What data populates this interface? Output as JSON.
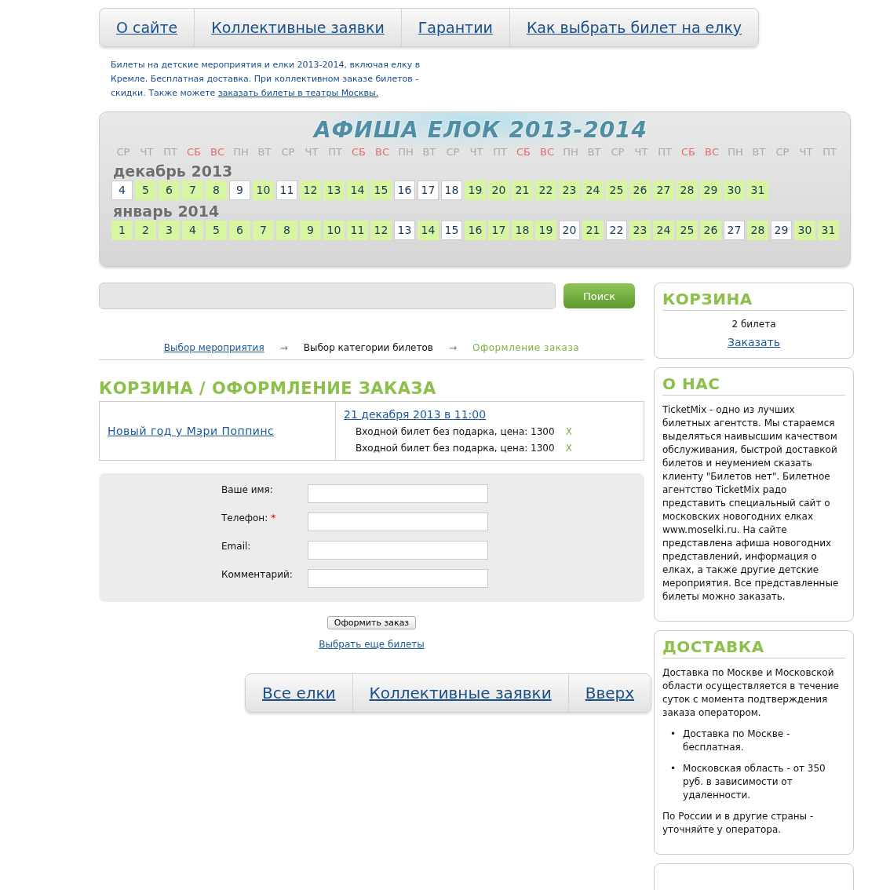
{
  "top_nav": [
    "О сайте",
    "Коллективные заявки",
    "Гарантии",
    "Как выбрать билет на елку"
  ],
  "intro": {
    "text": "Билеты на детские мероприятия и елки 2013-2014, включая елку в Кремле. Бесплатная доставка. При коллективном заказе билетов - скидки. Также можете ",
    "link": "заказать билеты в театры Москвы."
  },
  "calendar": {
    "title": "АФИША ЕЛОК 2013-2014",
    "weekdays": [
      {
        "label": "СР",
        "weekend": false
      },
      {
        "label": "ЧТ",
        "weekend": false
      },
      {
        "label": "ПТ",
        "weekend": false
      },
      {
        "label": "СБ",
        "weekend": true
      },
      {
        "label": "ВС",
        "weekend": true
      },
      {
        "label": "ПН",
        "weekend": false
      },
      {
        "label": "ВТ",
        "weekend": false
      },
      {
        "label": "СР",
        "weekend": false
      },
      {
        "label": "ЧТ",
        "weekend": false
      },
      {
        "label": "ПТ",
        "weekend": false
      },
      {
        "label": "СБ",
        "weekend": true
      },
      {
        "label": "ВС",
        "weekend": true
      },
      {
        "label": "ПН",
        "weekend": false
      },
      {
        "label": "ВТ",
        "weekend": false
      },
      {
        "label": "СР",
        "weekend": false
      },
      {
        "label": "ЧТ",
        "weekend": false
      },
      {
        "label": "ПТ",
        "weekend": false
      },
      {
        "label": "СБ",
        "weekend": true
      },
      {
        "label": "ВС",
        "weekend": true
      },
      {
        "label": "ПН",
        "weekend": false
      },
      {
        "label": "ВТ",
        "weekend": false
      },
      {
        "label": "СР",
        "weekend": false
      },
      {
        "label": "ЧТ",
        "weekend": false
      },
      {
        "label": "ПТ",
        "weekend": false
      },
      {
        "label": "СБ",
        "weekend": true
      },
      {
        "label": "ВС",
        "weekend": true
      },
      {
        "label": "ПН",
        "weekend": false
      },
      {
        "label": "ВТ",
        "weekend": false
      },
      {
        "label": "СР",
        "weekend": false
      },
      {
        "label": "ЧТ",
        "weekend": false
      },
      {
        "label": "ПТ",
        "weekend": false
      }
    ],
    "months": [
      {
        "name": "декабрь 2013",
        "days": [
          {
            "day": "4",
            "available": false
          },
          {
            "day": "5",
            "available": true
          },
          {
            "day": "6",
            "available": true
          },
          {
            "day": "7",
            "available": true
          },
          {
            "day": "8",
            "available": true
          },
          {
            "day": "9",
            "available": false
          },
          {
            "day": "10",
            "available": true
          },
          {
            "day": "11",
            "available": false
          },
          {
            "day": "12",
            "available": true
          },
          {
            "day": "13",
            "available": true
          },
          {
            "day": "14",
            "available": true
          },
          {
            "day": "15",
            "available": true
          },
          {
            "day": "16",
            "available": false
          },
          {
            "day": "17",
            "available": false
          },
          {
            "day": "18",
            "available": false
          },
          {
            "day": "19",
            "available": true
          },
          {
            "day": "20",
            "available": true
          },
          {
            "day": "21",
            "available": true
          },
          {
            "day": "22",
            "available": true
          },
          {
            "day": "23",
            "available": true
          },
          {
            "day": "24",
            "available": true
          },
          {
            "day": "25",
            "available": true
          },
          {
            "day": "26",
            "available": true
          },
          {
            "day": "27",
            "available": true
          },
          {
            "day": "28",
            "available": true
          },
          {
            "day": "29",
            "available": true
          },
          {
            "day": "30",
            "available": true
          },
          {
            "day": "31",
            "available": true
          }
        ]
      },
      {
        "name": "январь 2014",
        "days": [
          {
            "day": "1",
            "available": true
          },
          {
            "day": "2",
            "available": true
          },
          {
            "day": "3",
            "available": true
          },
          {
            "day": "4",
            "available": true
          },
          {
            "day": "5",
            "available": true
          },
          {
            "day": "6",
            "available": true
          },
          {
            "day": "7",
            "available": true
          },
          {
            "day": "8",
            "available": true
          },
          {
            "day": "9",
            "available": true
          },
          {
            "day": "10",
            "available": true
          },
          {
            "day": "11",
            "available": true
          },
          {
            "day": "12",
            "available": true
          },
          {
            "day": "13",
            "available": false
          },
          {
            "day": "14",
            "available": true
          },
          {
            "day": "15",
            "available": false
          },
          {
            "day": "16",
            "available": true
          },
          {
            "day": "17",
            "available": true
          },
          {
            "day": "18",
            "available": true
          },
          {
            "day": "19",
            "available": true
          },
          {
            "day": "20",
            "available": false
          },
          {
            "day": "21",
            "available": true
          },
          {
            "day": "22",
            "available": false
          },
          {
            "day": "23",
            "available": true
          },
          {
            "day": "24",
            "available": true
          },
          {
            "day": "25",
            "available": true
          },
          {
            "day": "26",
            "available": true
          },
          {
            "day": "27",
            "available": false
          },
          {
            "day": "28",
            "available": true
          },
          {
            "day": "29",
            "available": false
          },
          {
            "day": "30",
            "available": true
          },
          {
            "day": "31",
            "available": true
          }
        ]
      }
    ]
  },
  "search": {
    "button": "Поиск"
  },
  "steps": [
    {
      "label": "Выбор мероприятия",
      "kind": "link"
    },
    {
      "label": "Выбор категории билетов",
      "kind": "plain"
    },
    {
      "label": "Оформление заказа",
      "kind": "active"
    }
  ],
  "step_arrow": "→",
  "heading": "КОРЗИНА / ОФОРМЛЕНИЕ ЗАКАЗА",
  "order": {
    "event": "Новый год у Мэри Поппинс",
    "session": "21 декабря 2013 в 11:00",
    "tickets": [
      {
        "text": "Входной билет без подарка, цена: 1300",
        "remove": "X"
      },
      {
        "text": "Входной билет без подарка, цена: 1300",
        "remove": "X"
      }
    ]
  },
  "form": {
    "fields": [
      {
        "label": "Ваше имя:",
        "required": false
      },
      {
        "label": "Телефон:",
        "required": true
      },
      {
        "label": "Email:",
        "required": false
      },
      {
        "label": "Комментарий:",
        "required": false
      }
    ],
    "required_mark": "*",
    "submit": "Оформить заказ",
    "more_link": "Выбрать еще билеты"
  },
  "bottom_nav": [
    "Все елки",
    "Коллективные заявки",
    "Вверх"
  ],
  "sidebar": [
    {
      "kind": "cart",
      "title": "КОРЗИНА",
      "count": "2 билета",
      "link": "Заказать"
    },
    {
      "kind": "text",
      "title": "О НАС",
      "paragraphs": [
        "TicketMix - одно из лучших билетных агентств. Мы стараемся выделяться наивысшим качеством обслуживания, быстрой доставкой билетов и неумением сказать клиенту \"Билетов нет\". Билетное агентство TicketMix радо представить специальный сайт о московских новогодних елках www.moselki.ru. На сайте представлена афиша новогодних представлений, информация о елках, а также другие детские мероприятия. Все представленные билеты можно заказать."
      ]
    },
    {
      "kind": "text",
      "title": "ДОСТАВКА",
      "paragraphs": [
        "Доставка по Москве и Московской области осуществляется в течение суток с момента подтверждения заказа оператором."
      ],
      "bullet": "•",
      "bullets": [
        "Доставка по Москве - бесплатная.",
        "Московская область - от 350 руб. в зависимости от удаленности."
      ],
      "footer": "По России и в другие страны - уточняйте у оператора."
    }
  ]
}
